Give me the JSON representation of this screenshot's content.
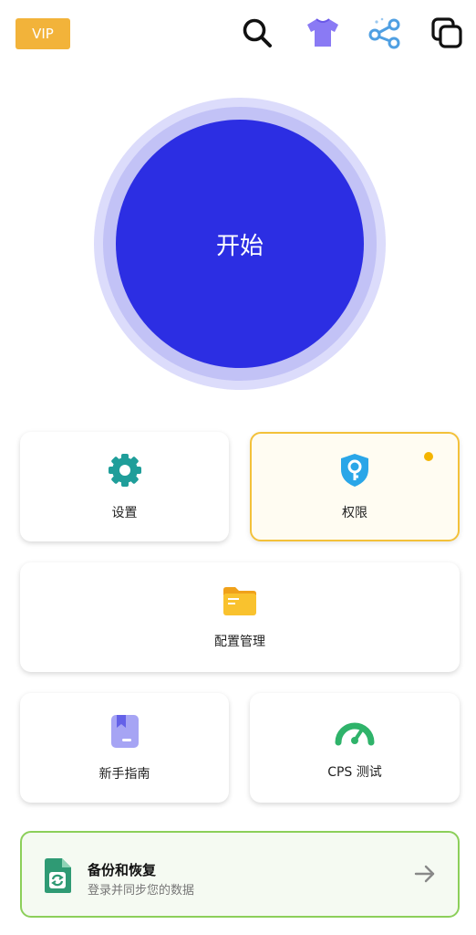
{
  "header": {
    "vip_label": "VIP",
    "icons": [
      "search-icon",
      "tshirt-icon",
      "share-icon",
      "copy-windows-icon"
    ],
    "colors": {
      "vip": "#f2b33a",
      "tshirt": "#7b6ef6",
      "share": "#5aa9e6"
    }
  },
  "start": {
    "label": "开始",
    "color": "#2c2ee3"
  },
  "cards": {
    "settings": {
      "label": "设置",
      "icon": "gear-icon",
      "color": "#1f9e9a"
    },
    "permission": {
      "label": "权限",
      "icon": "shield-key-icon",
      "color": "#2aa6e8"
    },
    "config": {
      "label": "配置管理",
      "icon": "folder-icon",
      "color": "#f5b21e"
    },
    "guide": {
      "label": "新手指南",
      "icon": "guide-book-icon",
      "color": "#8f8ef0"
    },
    "cps": {
      "label": "CPS 测试",
      "icon": "speedometer-icon",
      "color": "#2fb36a"
    }
  },
  "backup": {
    "title": "备份和恢复",
    "subtitle": "登录并同步您的数据",
    "icon": "backup-file-icon",
    "border_color": "#8ccf5a"
  }
}
